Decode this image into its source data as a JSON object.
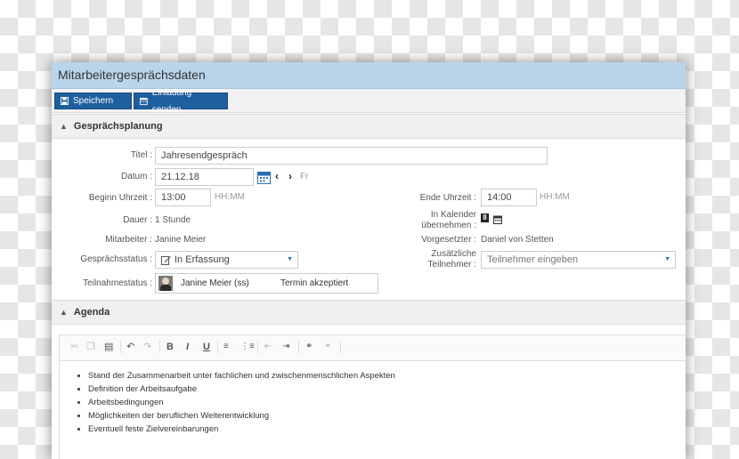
{
  "window": {
    "title": "Mitarbeitergesprächsdaten"
  },
  "toolbar": {
    "save_label": "Speichern",
    "invite_label": "Einladung senden"
  },
  "planning": {
    "section_title": "Gesprächsplanung",
    "title_label": "Titel :",
    "title_value": "Jahresendgespräch",
    "date_label": "Datum :",
    "date_value": "21.12.18",
    "date_weekday": "Fr",
    "start_label": "Beginn Uhrzeit :",
    "start_value": "13:00",
    "start_hint": "HH:MM",
    "end_label": "Ende Uhrzeit :",
    "end_value": "14:00",
    "end_hint": "HH:MM",
    "duration_label": "Dauer :",
    "duration_value": "1 Stunde",
    "calendar_label_1": "In Kalender",
    "calendar_label_2": "übernehmen :",
    "employee_label": "Mitarbeiter :",
    "employee_value": "Janine Meier",
    "supervisor_label": "Vorgesetzter :",
    "supervisor_value": "Daniel von Stetten",
    "status_label": "Gesprächsstatus :",
    "status_value": "In Erfassung",
    "additional_label_1": "Zusätzliche",
    "additional_label_2": "Teilnehmer :",
    "additional_placeholder": "Teilnehmer eingeben",
    "participation_label": "Teilnahmestatus :",
    "participant_name": "Janine Meier (ss)",
    "participant_status": "Termin akzeptiert"
  },
  "agenda": {
    "section_title": "Agenda",
    "items": [
      "Stand der Zusammenarbeit unter fachlichen und zwischenmenschlichen Aspekten",
      "Definition der Arbeitsaufgabe",
      "Arbeitsbedingungen",
      "Möglichkeiten der beruflichen Weiterentwicklung",
      "Eventuell feste Zielvereinbarungen"
    ]
  },
  "colors": {
    "titlebar": "#b9d5ec",
    "button": "#1f5f9f",
    "accent": "#2a6db3"
  }
}
